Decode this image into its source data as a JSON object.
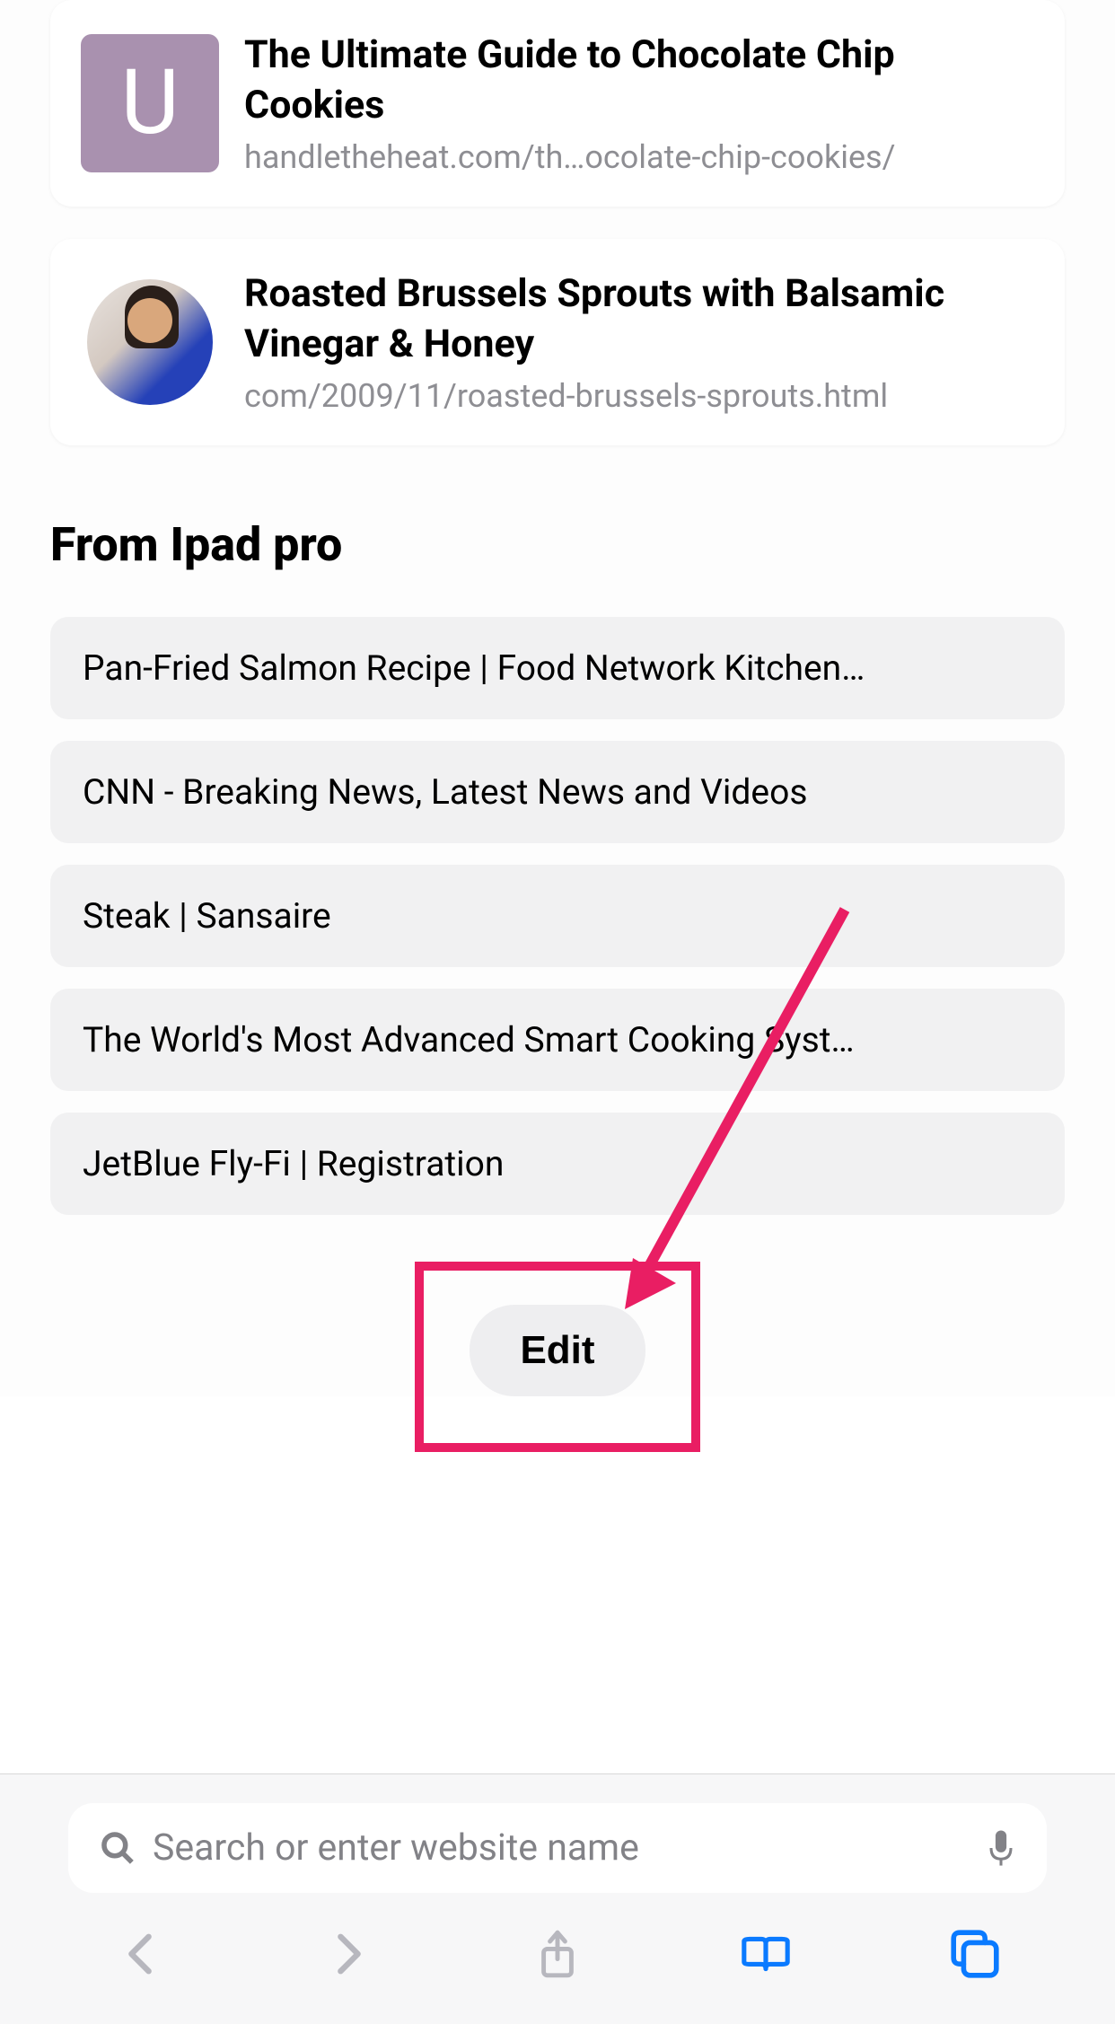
{
  "tabs": [
    {
      "iconType": "letter",
      "iconLetter": "U",
      "title": "The Ultimate Guide to Chocolate Chip Cookies",
      "url": "handletheheat.com/th…ocolate-chip-cookies/"
    },
    {
      "iconType": "avatar",
      "title": "Roasted Brussels Sprouts with Balsamic Vinegar & Honey",
      "url": "com/2009/11/roasted-brussels-sprouts.html"
    }
  ],
  "section": {
    "title": "From Ipad pro"
  },
  "remoteTabs": [
    {
      "title": "Pan-Fried Salmon Recipe | Food Network Kitchen…"
    },
    {
      "title": "CNN - Breaking News, Latest News and Videos"
    },
    {
      "title": "Steak | Sansaire"
    },
    {
      "title": "The World's Most Advanced Smart Cooking Syst…"
    },
    {
      "title": "JetBlue Fly-Fi | Registration"
    }
  ],
  "editButton": {
    "label": "Edit"
  },
  "search": {
    "placeholder": "Search or enter website name"
  },
  "annotation": {
    "color": "#e91e63"
  }
}
